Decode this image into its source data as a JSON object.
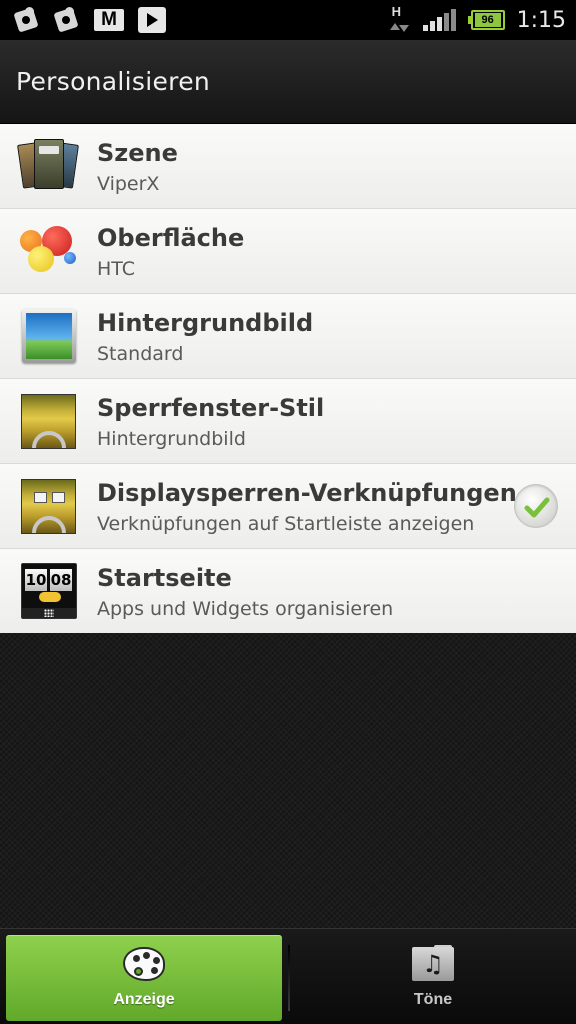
{
  "status_bar": {
    "time": "1:15",
    "battery_level": "96",
    "network_type": "H",
    "signal_bars_on": 3,
    "signal_bars_total": 5,
    "notification_icons": [
      "puzzle-icon",
      "puzzle-icon",
      "gmail-icon",
      "play-store-icon"
    ],
    "colors": {
      "battery": "#8dc63f"
    }
  },
  "header": {
    "title": "Personalisieren"
  },
  "settings": {
    "items": [
      {
        "title": "Szene",
        "subtitle": "ViperX",
        "icon": "scene-icon"
      },
      {
        "title": "Oberfläche",
        "subtitle": "HTC",
        "icon": "skin-icon"
      },
      {
        "title": "Hintergrundbild",
        "subtitle": "Standard",
        "icon": "wallpaper-icon"
      },
      {
        "title": "Sperrfenster-Stil",
        "subtitle": "Hintergrundbild",
        "icon": "lockscreen-icon"
      },
      {
        "title": "Displaysperren-Verknüpfungen",
        "subtitle": "Verknüpfungen auf Startleiste anzeigen",
        "icon": "lockscreen-shortcuts-icon",
        "checked": true
      },
      {
        "title": "Startseite",
        "subtitle": "Apps und Widgets organisieren",
        "icon": "home-icon",
        "clock_hours": "10",
        "clock_minutes": "08"
      }
    ]
  },
  "tabs": [
    {
      "label": "Anzeige",
      "icon": "palette-icon",
      "active": true
    },
    {
      "label": "Töne",
      "icon": "music-note-icon",
      "active": false
    }
  ],
  "colors": {
    "accent": "#7bc043",
    "list_background": "#f4f4f2",
    "title_text": "#3a3a3a"
  }
}
